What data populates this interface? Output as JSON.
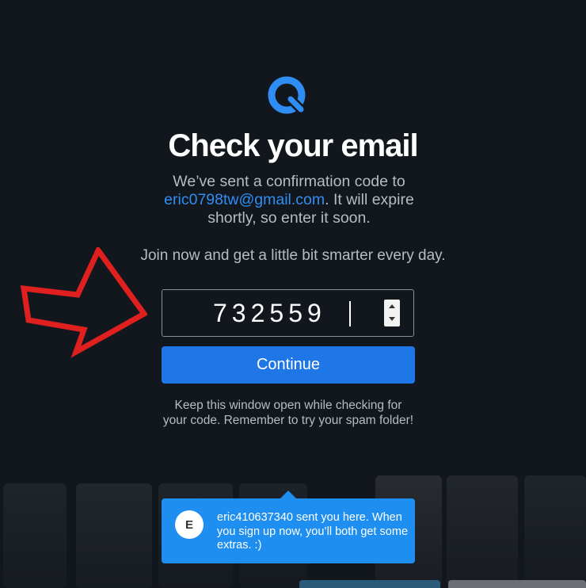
{
  "colors": {
    "background": "#12171e",
    "accent": "#1f76e6",
    "link": "#2f8ef4",
    "arrow": "#e0201f"
  },
  "logo": {
    "icon": "search-logo-icon"
  },
  "heading": {
    "title": "Check your email"
  },
  "message": {
    "prefix": "We’ve sent a confirmation code to ",
    "email": "eric0798tw@gmail.com",
    "suffix": ". It will expire shortly, so enter it soon."
  },
  "tagline": "Join now and get a little bit smarter every day.",
  "code_input": {
    "value": "732559"
  },
  "continue_button": {
    "label": "Continue"
  },
  "hint": "Keep this window open while checking for your code. Remember to try your spam folder!",
  "referral": {
    "avatar_letter": "E",
    "message": "eric410637340 sent you here. When you sign up now, you’ll both get some extras. :)"
  }
}
